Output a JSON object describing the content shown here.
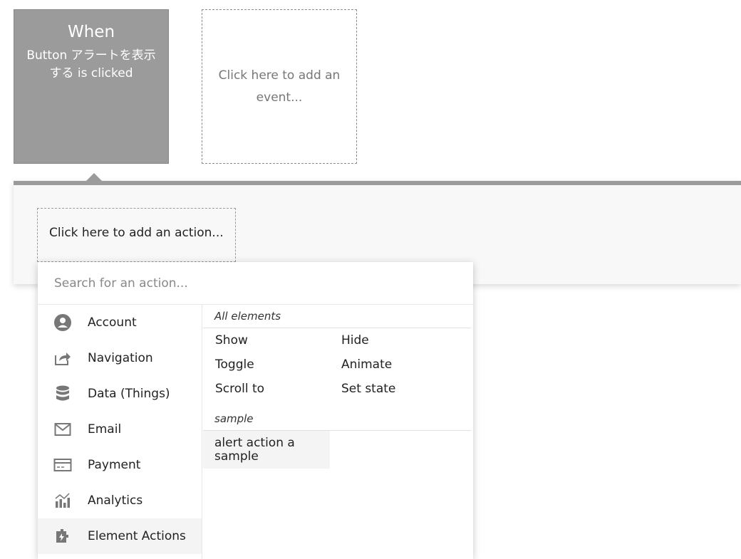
{
  "trigger": {
    "title": "When",
    "description": "Button アラートを表示する is clicked"
  },
  "add_event": {
    "label": "Click here to add an event..."
  },
  "add_action": {
    "label": "Click here to add an action..."
  },
  "search": {
    "placeholder": "Search for an action..."
  },
  "categories": [
    {
      "label": "Account",
      "icon": "account-icon"
    },
    {
      "label": "Navigation",
      "icon": "navigation-icon"
    },
    {
      "label": "Data (Things)",
      "icon": "database-icon"
    },
    {
      "label": "Email",
      "icon": "email-icon"
    },
    {
      "label": "Payment",
      "icon": "payment-icon"
    },
    {
      "label": "Analytics",
      "icon": "analytics-icon"
    },
    {
      "label": "Element Actions",
      "icon": "element-actions-icon",
      "selected": true
    }
  ],
  "sections": {
    "all_elements": {
      "header": "All elements",
      "actions": [
        "Show",
        "Hide",
        "Toggle",
        "Animate",
        "Scroll to",
        "Set state"
      ]
    },
    "sample": {
      "header": "sample",
      "actions": [
        "alert action a sample"
      ]
    }
  },
  "colors": {
    "trigger_bg": "#9b9b9b",
    "panel_bg": "#f8f8f8",
    "selected_bg": "#f4f4f4"
  }
}
